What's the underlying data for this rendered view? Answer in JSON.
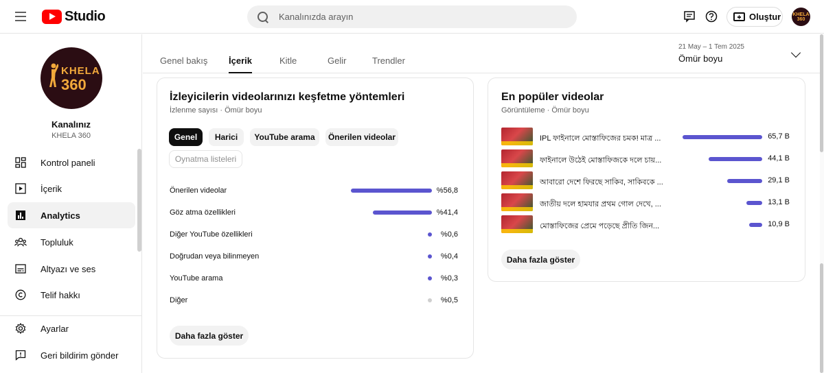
{
  "header": {
    "logo_text": "Studio",
    "search_placeholder": "Kanalınızda arayın",
    "create_label": "Oluştur",
    "avatar_text": "KHELA 360"
  },
  "sidebar": {
    "channel_title": "Kanalınız",
    "channel_name": "KHELA 360",
    "avatar_line1": "KHELA",
    "avatar_line2": "360",
    "items": [
      {
        "label": "Kontrol paneli",
        "icon": "dashboard-icon"
      },
      {
        "label": "İçerik",
        "icon": "content-icon"
      },
      {
        "label": "Analytics",
        "icon": "analytics-icon",
        "active": true
      },
      {
        "label": "Topluluk",
        "icon": "community-icon"
      },
      {
        "label": "Altyazı ve ses",
        "icon": "subtitles-icon"
      },
      {
        "label": "Telif hakkı",
        "icon": "copyright-icon"
      }
    ],
    "bottom_items": [
      {
        "label": "Ayarlar",
        "icon": "settings-icon"
      },
      {
        "label": "Geri bildirim gönder",
        "icon": "feedback-icon"
      }
    ]
  },
  "tabs": {
    "items": [
      "Genel bakış",
      "İçerik",
      "Kitle",
      "Gelir",
      "Trendler"
    ],
    "active": "İçerik"
  },
  "date_range": {
    "range": "21 May – 1 Tem 2025",
    "label": "Ömür boyu"
  },
  "traffic_card": {
    "title": "İzleyicilerin videolarınızı keşfetme yöntemleri",
    "subtitle": "İzlenme sayısı · Ömür boyu",
    "chips": [
      "Genel",
      "Harici",
      "YouTube arama",
      "Önerilen videolar",
      "Oynatma listeleri"
    ],
    "active_chip": "Genel",
    "disabled_chip": "Oynatma listeleri",
    "rows": [
      {
        "label": "Önerilen videolar",
        "value": "%56,8",
        "share": 56.8
      },
      {
        "label": "Göz atma özellikleri",
        "value": "%41,4",
        "share": 41.4
      },
      {
        "label": "Diğer YouTube özellikleri",
        "value": "%0,6",
        "share": 0.6
      },
      {
        "label": "Doğrudan veya bilinmeyen",
        "value": "%0,4",
        "share": 0.4
      },
      {
        "label": "YouTube arama",
        "value": "%0,3",
        "share": 0.3
      },
      {
        "label": "Diğer",
        "value": "%0,5",
        "share": 0.5,
        "grey": true
      }
    ],
    "more_label": "Daha fazla göster"
  },
  "top_videos_card": {
    "title": "En popüler videolar",
    "subtitle": "Görüntüleme · Ömür boyu",
    "rows": [
      {
        "title": "IPL ফাইনালে মোস্তাফিজের চমক! মাত্র ...",
        "value": "65,7 B",
        "views": 65.7
      },
      {
        "title": "ফাইনালে উঠেই মোস্তাফিজকে দলে চায়...",
        "value": "44,1 B",
        "views": 44.1
      },
      {
        "title": "আবারো দেশে ফিরছে সাকিব, সাকিবকে ...",
        "value": "29,1 B",
        "views": 29.1
      },
      {
        "title": "জাতীয় দলে হামযার প্রথম গোল দেখে, ...",
        "value": "13,1 B",
        "views": 13.1
      },
      {
        "title": "মোস্তাফিজের প্রেমে পড়েছে প্রীতি জিন...",
        "value": "10,9 B",
        "views": 10.9
      }
    ],
    "more_label": "Daha fazla göster"
  },
  "colors": {
    "bar": "#5b55cf",
    "accent_red": "#ff0000"
  }
}
